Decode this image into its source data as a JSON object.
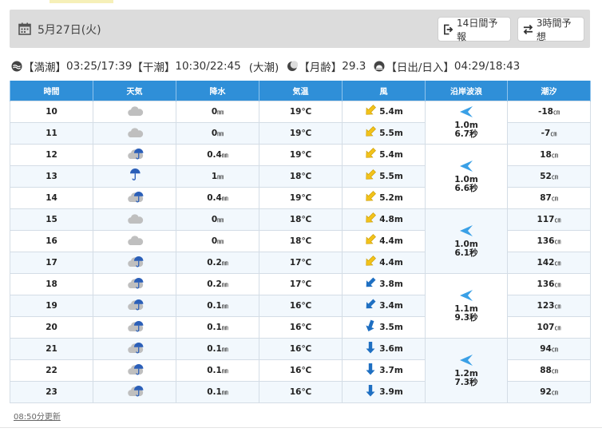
{
  "header": {
    "date": "5月27日(火)",
    "btn_14day": "14日間予報",
    "btn_3hour": "3時間予想"
  },
  "tide": {
    "high_label": "【満潮】",
    "high_value": "03:25/17:39",
    "low_label": "【干潮】",
    "low_value": "10:30/22:45",
    "type": "(大潮)",
    "moon_label": "【月齢】",
    "moon_value": "29.3",
    "sun_label": "【日出/日入】",
    "sun_value": "04:29/18:43"
  },
  "table": {
    "headers": [
      "時間",
      "天気",
      "降水",
      "気温",
      "風",
      "沿岸波浪",
      "潮汐"
    ],
    "rows": [
      {
        "hour": "10",
        "weather": "cloudy-icon",
        "precip": "0",
        "temp": "19℃",
        "wind": "5.4m",
        "wind_dir": "sw",
        "tide": "-18"
      },
      {
        "hour": "11",
        "weather": "cloudy-icon",
        "precip": "0",
        "temp": "19℃",
        "wind": "5.5m",
        "wind_dir": "sw",
        "tide": "-7"
      },
      {
        "hour": "12",
        "weather": "cloudy-rain-icon",
        "precip": "0.4",
        "temp": "19℃",
        "wind": "5.4m",
        "wind_dir": "sw",
        "tide": "18"
      },
      {
        "hour": "13",
        "weather": "umbrella-icon",
        "precip": "1",
        "temp": "18℃",
        "wind": "5.5m",
        "wind_dir": "sw",
        "tide": "52"
      },
      {
        "hour": "14",
        "weather": "cloudy-rain-icon",
        "precip": "0.4",
        "temp": "19℃",
        "wind": "5.2m",
        "wind_dir": "sw",
        "tide": "87"
      },
      {
        "hour": "15",
        "weather": "cloudy-icon",
        "precip": "0",
        "temp": "18℃",
        "wind": "4.8m",
        "wind_dir": "sw",
        "tide": "117"
      },
      {
        "hour": "16",
        "weather": "cloudy-icon",
        "precip": "0",
        "temp": "18℃",
        "wind": "4.4m",
        "wind_dir": "sw",
        "tide": "136"
      },
      {
        "hour": "17",
        "weather": "cloudy-rain-icon",
        "precip": "0.2",
        "temp": "17℃",
        "wind": "4.4m",
        "wind_dir": "sw",
        "tide": "142"
      },
      {
        "hour": "18",
        "weather": "cloudy-rain-icon",
        "precip": "0.2",
        "temp": "17℃",
        "wind": "3.8m",
        "wind_dir": "sw-blue",
        "tide": "136"
      },
      {
        "hour": "19",
        "weather": "cloudy-rain-icon",
        "precip": "0.1",
        "temp": "16℃",
        "wind": "3.4m",
        "wind_dir": "sw-blue",
        "tide": "123"
      },
      {
        "hour": "20",
        "weather": "cloudy-rain-icon",
        "precip": "0.1",
        "temp": "16℃",
        "wind": "3.5m",
        "wind_dir": "ssw-blue",
        "tide": "107"
      },
      {
        "hour": "21",
        "weather": "cloudy-rain-icon",
        "precip": "0.1",
        "temp": "16℃",
        "wind": "3.6m",
        "wind_dir": "s-blue",
        "tide": "94"
      },
      {
        "hour": "22",
        "weather": "cloudy-rain-icon",
        "precip": "0.1",
        "temp": "16℃",
        "wind": "3.7m",
        "wind_dir": "s-blue",
        "tide": "88"
      },
      {
        "hour": "23",
        "weather": "cloudy-rain-icon",
        "precip": "0.1",
        "temp": "16℃",
        "wind": "3.9m",
        "wind_dir": "s-blue",
        "tide": "92"
      }
    ],
    "waves": [
      {
        "height": "1.0m",
        "period": "6.7秒"
      },
      {
        "height": "1.0m",
        "period": "6.6秒"
      },
      {
        "height": "1.0m",
        "period": "6.1秒"
      },
      {
        "height": "1.1m",
        "period": "9.3秒"
      },
      {
        "height": "1.2m",
        "period": "7.3秒"
      }
    ],
    "precip_unit": "㎜",
    "tide_unit": "㎝"
  },
  "footer": {
    "updated": "08:50分更新"
  },
  "colors": {
    "header_blue": "#2f8fd8",
    "wind_yellow": "#f2c21a",
    "wind_blue": "#1e6fc2",
    "wave_blue": "#3aa0e6"
  }
}
